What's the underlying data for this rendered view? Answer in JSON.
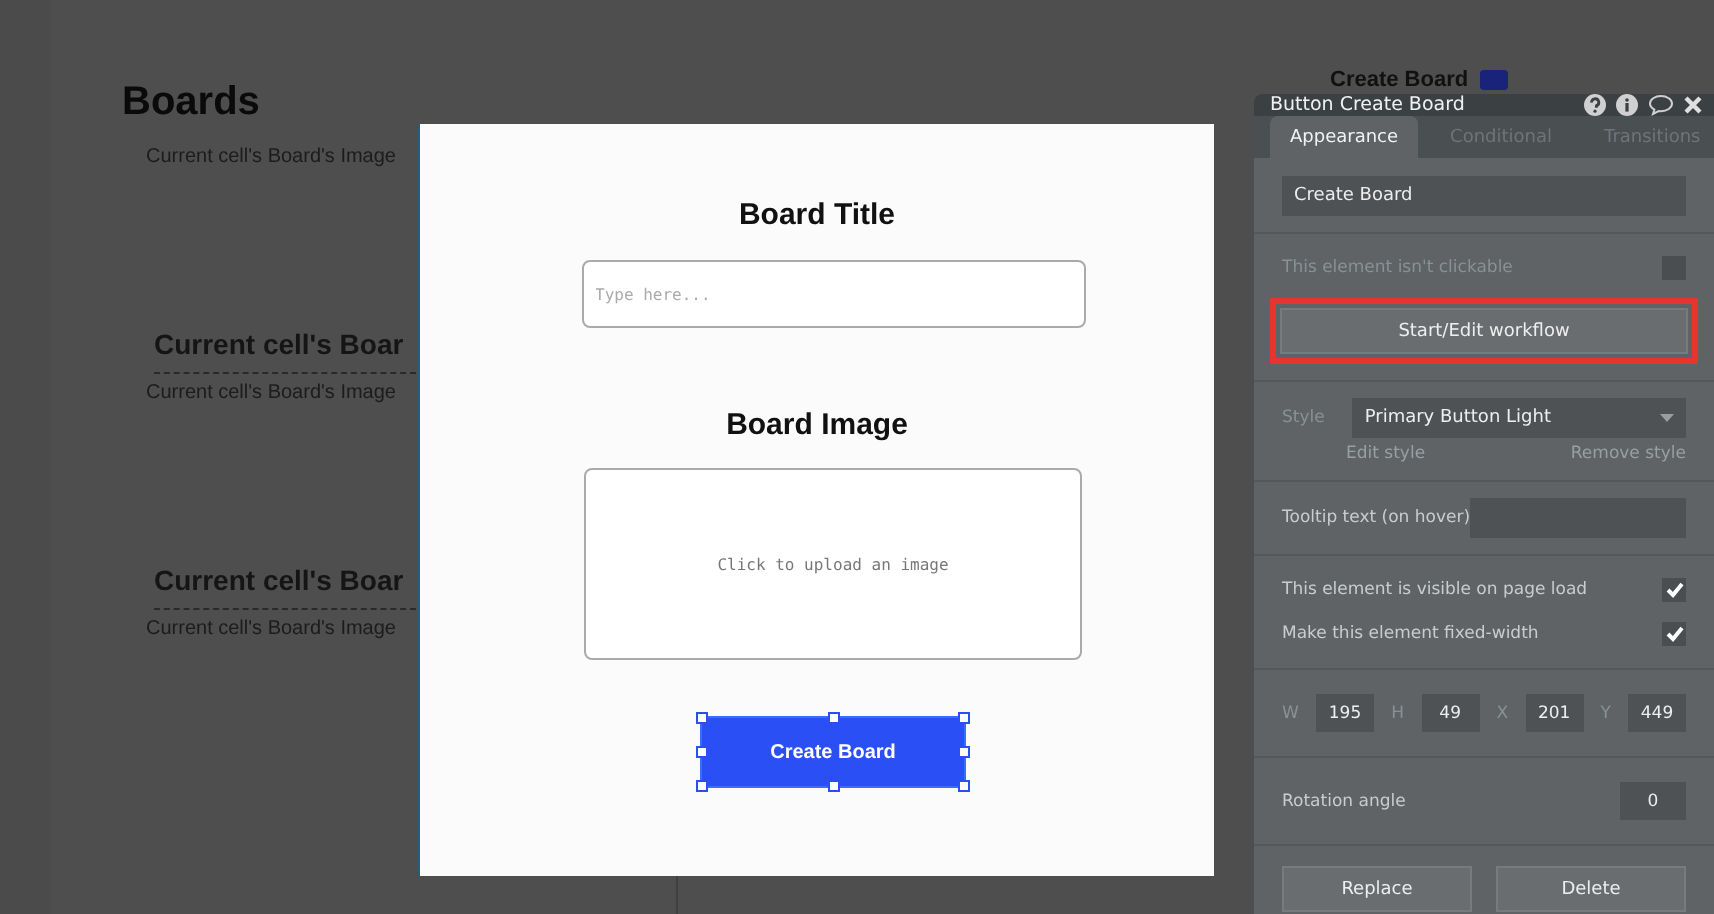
{
  "canvas": {
    "title": "Boards",
    "header_button": "Create Board",
    "items": [
      {
        "caption": "Current cell's Board's Image"
      },
      {
        "caption": "Current cell's Board's Image",
        "heading": "Current cell's Boar"
      },
      {
        "caption": "Current cell's Board's Image",
        "heading": "Current cell's Boar"
      }
    ]
  },
  "popup": {
    "title_label": "Board Title",
    "title_placeholder": "Type here...",
    "image_label": "Board Image",
    "image_hint": "Click to upload an image",
    "button": "Create Board",
    "button_selected": true
  },
  "panel": {
    "title": "Button Create Board",
    "tabs": [
      {
        "label": "Appearance",
        "selected": true
      },
      {
        "label": "Conditional",
        "selected": false
      },
      {
        "label": "Transitions",
        "selected": false
      }
    ],
    "text_value": "Create Board",
    "not_clickable": {
      "label": "This element isn't clickable",
      "checked": false
    },
    "workflow_button": "Start/Edit workflow",
    "workflow_highlighted": true,
    "style": {
      "label": "Style",
      "value": "Primary Button Light",
      "edit": "Edit style",
      "remove": "Remove style"
    },
    "tooltip_label": "Tooltip text (on hover)",
    "checks": [
      {
        "label": "This element is visible on page load",
        "checked": true
      },
      {
        "label": "Make this element fixed-width",
        "checked": true
      }
    ],
    "dims": [
      {
        "label": "W",
        "value": "195"
      },
      {
        "label": "H",
        "value": "49"
      },
      {
        "label": "X",
        "value": "201"
      },
      {
        "label": "Y",
        "value": "449"
      }
    ],
    "rotation": {
      "label": "Rotation angle",
      "value": "0"
    },
    "buttons": [
      "Replace",
      "Delete"
    ]
  }
}
